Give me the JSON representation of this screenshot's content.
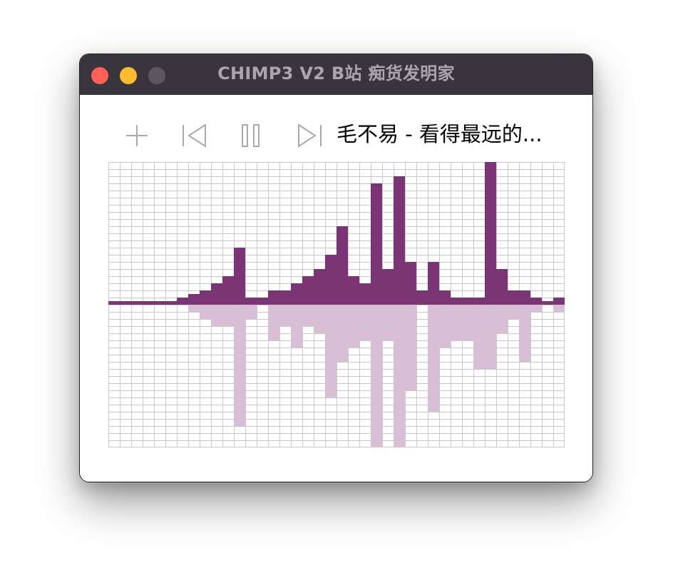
{
  "window": {
    "title": "CHIMP3 V2 B站 痴货发明家",
    "traffic_lights": {
      "close": "#fe5f57",
      "minimize": "#febc2e",
      "zoom": "#5a575e"
    }
  },
  "controls": {
    "add_icon": "plus-icon",
    "prev_icon": "skip-previous-icon",
    "pause_icon": "pause-icon",
    "next_icon": "skip-next-icon"
  },
  "now_playing": {
    "title": "毛不易 - 看得最远的..."
  },
  "colors": {
    "accent": "#7b3575",
    "accent_light": "#d9bfd5",
    "grid": "#c8c8c8",
    "icon": "#aaaaaa"
  },
  "visualizer": {
    "bins": 40,
    "grid_columns": 40,
    "grid_rows": 40,
    "upper_values": [
      0.5,
      0.5,
      0.5,
      0.5,
      0.5,
      0.5,
      1,
      1.5,
      2,
      3,
      4,
      8,
      1,
      1,
      2,
      2,
      3,
      4,
      5,
      7,
      11,
      4,
      3,
      17,
      5,
      18,
      6,
      2,
      6,
      2,
      1,
      1,
      1,
      23,
      5,
      2,
      2,
      1,
      0.5,
      1
    ],
    "lower_values": [
      0,
      0,
      0,
      0,
      0,
      0,
      0,
      1,
      2,
      3,
      3,
      17,
      2,
      0,
      5,
      3,
      6,
      3,
      4,
      13,
      8,
      6,
      5,
      23,
      5,
      23,
      12,
      0,
      15,
      6,
      5,
      5,
      9,
      9,
      4,
      2,
      8,
      1,
      0,
      1
    ]
  }
}
